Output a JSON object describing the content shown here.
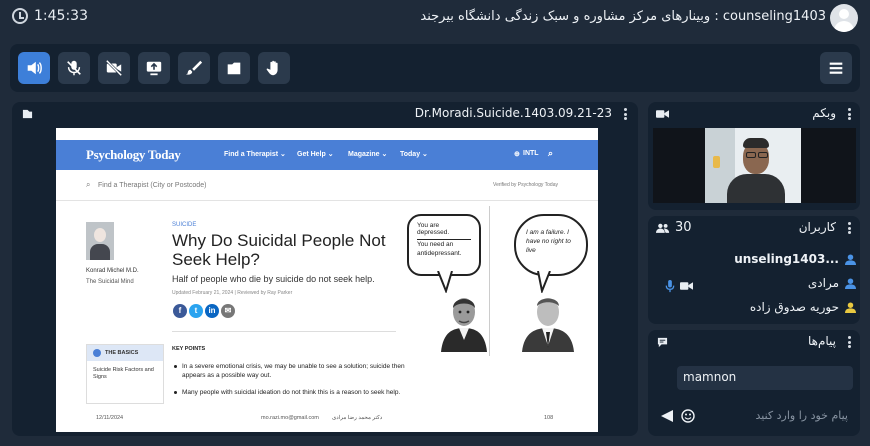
{
  "topbar": {
    "timer": "1:45:33",
    "title": "counseling1403 : وبینارهای مرکز مشاوره و سبک زندگی دانشگاه بیرجند"
  },
  "toolbar": {
    "buttons": [
      "speaker-icon",
      "mic-off-icon",
      "camera-off-icon",
      "share-screen-icon",
      "brush-icon",
      "folder-icon",
      "raise-hand-icon"
    ],
    "active": "speaker-icon",
    "accent": "#3d7fd9"
  },
  "presentation": {
    "filename": "Dr.Moradi.Suicide.1403.09.21-23",
    "slide": {
      "logo": "Psychology Today",
      "nav": [
        "Find a Therapist ⌄",
        "Get Help ⌄",
        "Magazine ⌄",
        "Today ⌄"
      ],
      "intl": "INTL",
      "search_placeholder": "Find a Therapist (City or Postcode)",
      "verified": "Verified by Psychology Today",
      "author_name": "Konrad Michel M.D.",
      "author_blog": "The Suicidal Mind",
      "tag": "SUICIDE",
      "headline": "Why Do Suicidal People Not Seek Help?",
      "deck": "Half of people who die by suicide do not seek help.",
      "meta": "Updated February 21, 2024 | Reviewed by Ray Parker",
      "basics_title": "THE BASICS",
      "basics_link": "Suicide Risk Factors and Signs",
      "key_points": "KEY POINTS",
      "bullets": [
        "In a severe emotional crisis, we may be unable to see a solution; suicide then appears as a possible way out.",
        "Many people with suicidal ideation do not think this is a reason to seek help."
      ],
      "bubble_left_1": "You are depressed.",
      "bubble_left_2": "You need an antidepressant.",
      "bubble_right": "I am a failure. I have no right to live",
      "footer_date": "12/11/2024",
      "footer_email": "mo.razi.mo@gmail.com",
      "footer_name": "دکتر محمد رضا مرادی",
      "footer_page": "108"
    }
  },
  "webcam": {
    "title": "وبکم"
  },
  "users": {
    "title": "کاربران",
    "count": "30",
    "list": [
      {
        "name": "...unseling1403",
        "bold": true
      },
      {
        "name": "مرادی"
      },
      {
        "name": "حوریه صدوق زاده"
      }
    ]
  },
  "messages": {
    "title": "پیام‌ها",
    "items": [
      "mamnon"
    ],
    "placeholder": "پیام خود را وارد کنید"
  }
}
